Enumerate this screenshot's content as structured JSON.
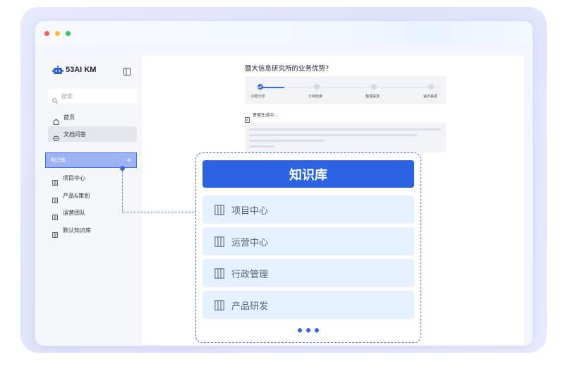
{
  "window": {
    "controls": [
      "close",
      "minimize",
      "maximize"
    ]
  },
  "sidebar": {
    "brand": "53AI KM",
    "search_placeholder": "搜索",
    "nav": [
      {
        "label": "首页",
        "icon": "home-icon"
      },
      {
        "label": "文档问答",
        "icon": "chat-icon",
        "active": true
      }
    ],
    "kb_header": "知识库",
    "kb_add": "+",
    "kb_items": [
      "项目中心",
      "产品&策划",
      "运营团队",
      "默认知识库"
    ]
  },
  "main": {
    "question": "暨大信息研究所的业务优势?",
    "steps": [
      "问题分析",
      "文档检索",
      "整理答案",
      "输出答案"
    ],
    "active_step": 1,
    "generating": "答案生成中..."
  },
  "callout": {
    "title": "知识库",
    "items": [
      "项目中心",
      "运营中心",
      "行政管理",
      "产品研发"
    ]
  },
  "colors": {
    "accent": "#2c63e3",
    "item_bg": "#e6f1ff",
    "kb_header_bg": "#9db4f4"
  }
}
